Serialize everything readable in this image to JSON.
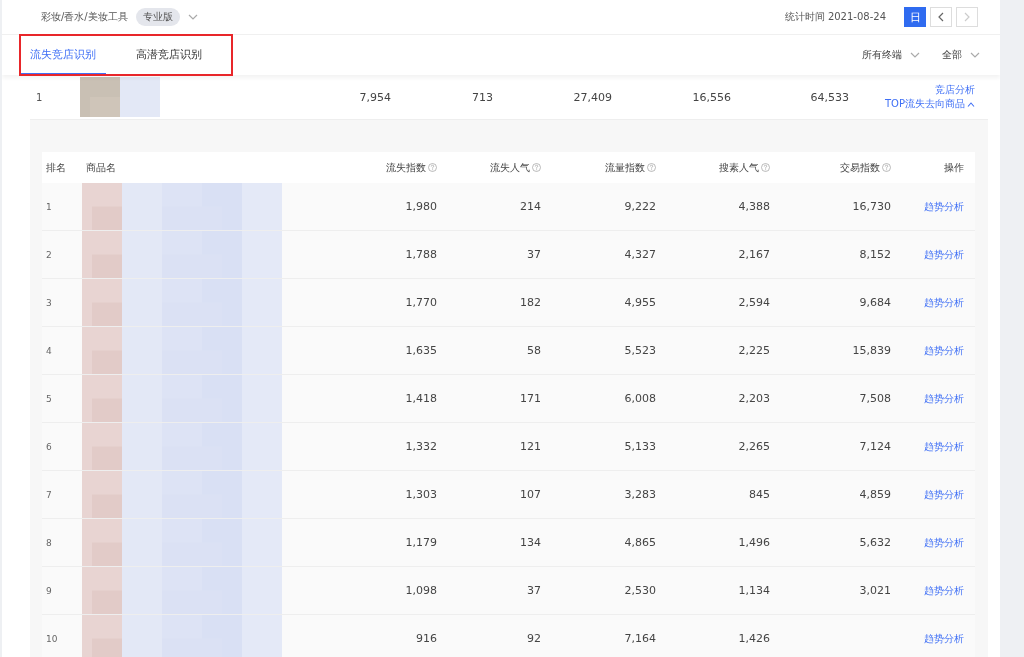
{
  "header": {
    "category": "彩妆/香水/美妆工具",
    "edition_badge": "专业版",
    "stat_time": "统计时间 2021-08-24",
    "period_buttons": [
      {
        "label": "日",
        "selected": true
      }
    ],
    "nav": [
      {
        "kind": "prev",
        "disabled": false
      },
      {
        "kind": "next",
        "disabled": true
      }
    ]
  },
  "tabs_highlighted": true,
  "tabs": [
    {
      "label": "流失竞店识别",
      "selected": true
    },
    {
      "label": "高潜竞店识别",
      "selected": false
    }
  ],
  "filters": [
    {
      "label": "所有终端"
    },
    {
      "label": "全部"
    }
  ],
  "summary_row": {
    "rank": "1",
    "values": [
      "7,954",
      "713",
      "27,409",
      "16,556",
      "64,533"
    ],
    "links": [
      "竞店分析",
      "TOP流失去向商品"
    ],
    "expanded": true
  },
  "table": {
    "columns": [
      {
        "label": "排名",
        "help": false
      },
      {
        "label": "商品名",
        "help": false
      },
      {
        "label": "流失指数",
        "help": true
      },
      {
        "label": "流失人气",
        "help": true
      },
      {
        "label": "流量指数",
        "help": true
      },
      {
        "label": "搜素人气",
        "help": true
      },
      {
        "label": "交易指数",
        "help": true
      },
      {
        "label": "操作",
        "help": false
      }
    ],
    "rows": [
      {
        "rank": "1",
        "values": [
          "1,980",
          "214",
          "9,222",
          "4,388",
          "16,730"
        ],
        "action": "趋势分析"
      },
      {
        "rank": "2",
        "values": [
          "1,788",
          "37",
          "4,327",
          "2,167",
          "8,152"
        ],
        "action": "趋势分析"
      },
      {
        "rank": "3",
        "values": [
          "1,770",
          "182",
          "4,955",
          "2,594",
          "9,684"
        ],
        "action": "趋势分析"
      },
      {
        "rank": "4",
        "values": [
          "1,635",
          "58",
          "5,523",
          "2,225",
          "15,839"
        ],
        "action": "趋势分析"
      },
      {
        "rank": "5",
        "values": [
          "1,418",
          "171",
          "6,008",
          "2,203",
          "7,508"
        ],
        "action": "趋势分析"
      },
      {
        "rank": "6",
        "values": [
          "1,332",
          "121",
          "5,133",
          "2,265",
          "7,124"
        ],
        "action": "趋势分析"
      },
      {
        "rank": "7",
        "values": [
          "1,303",
          "107",
          "3,283",
          "845",
          "4,859"
        ],
        "action": "趋势分析"
      },
      {
        "rank": "8",
        "values": [
          "1,179",
          "134",
          "4,865",
          "1,496",
          "5,632"
        ],
        "action": "趋势分析"
      },
      {
        "rank": "9",
        "values": [
          "1,098",
          "37",
          "2,530",
          "1,134",
          "3,021"
        ],
        "action": "趋势分析"
      },
      {
        "rank": "10",
        "values": [
          "916",
          "92",
          "7,164",
          "1,426"
        ],
        "action": "趋势分析"
      }
    ]
  }
}
